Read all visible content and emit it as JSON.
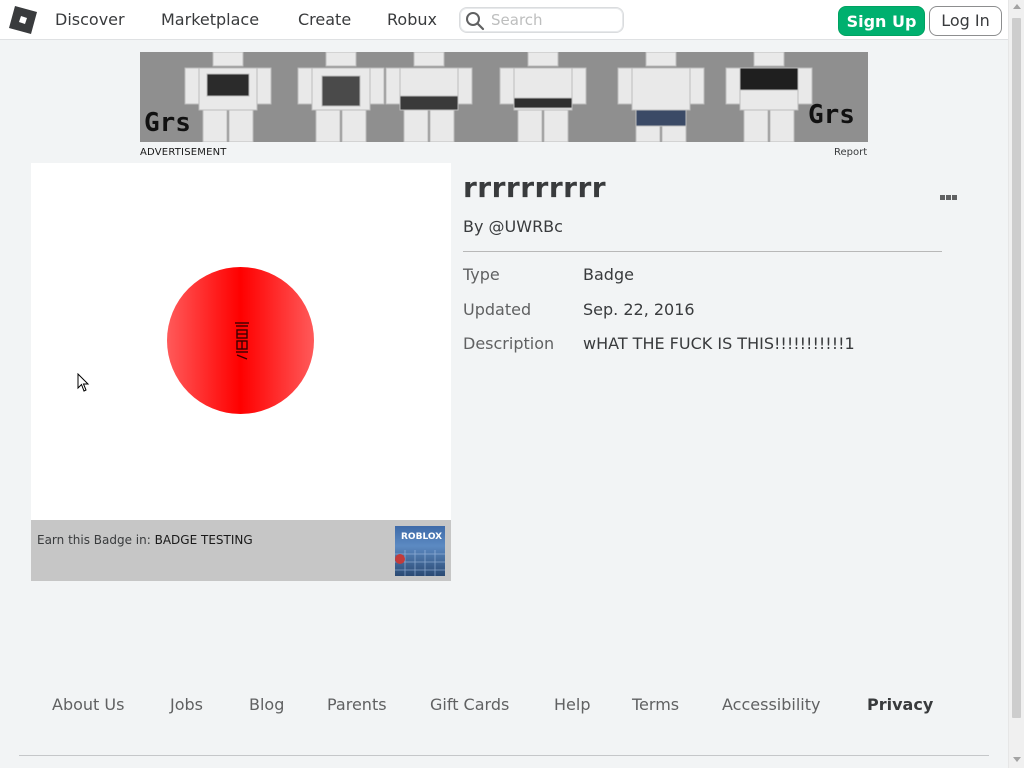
{
  "nav": {
    "logo_icon": "roblox-logo-icon",
    "links": [
      "Discover",
      "Marketplace",
      "Create",
      "Robux"
    ],
    "search_placeholder": "Search",
    "search_icon": "search-icon",
    "signup_label": "Sign Up",
    "login_label": "Log In"
  },
  "ad": {
    "label": "ADVERTISEMENT",
    "report": "Report",
    "brand_left": "Grs",
    "brand_right": "Grs"
  },
  "badge": {
    "earn_prefix": "Earn this Badge in: ",
    "game_name": "BADGE TESTING",
    "game_thumb_text": "ROBLOX"
  },
  "details": {
    "title": "rrrrrrrrrr",
    "by": "By @UWRBc",
    "more_icon": "more-options-icon",
    "rows": [
      {
        "label": "Type",
        "value": "Badge"
      },
      {
        "label": "Updated",
        "value": "Sep. 22, 2016"
      },
      {
        "label": "Description",
        "value": "wHAT THE FUCK IS THIS!!!!!!!!!!!1"
      }
    ]
  },
  "footer": {
    "links": [
      "About Us",
      "Jobs",
      "Blog",
      "Parents",
      "Gift Cards",
      "Help",
      "Terms",
      "Accessibility",
      "Privacy"
    ]
  },
  "colors": {
    "signup": "#00b06f",
    "badge_red": "#ff0000",
    "page_bg": "#f2f4f5"
  }
}
